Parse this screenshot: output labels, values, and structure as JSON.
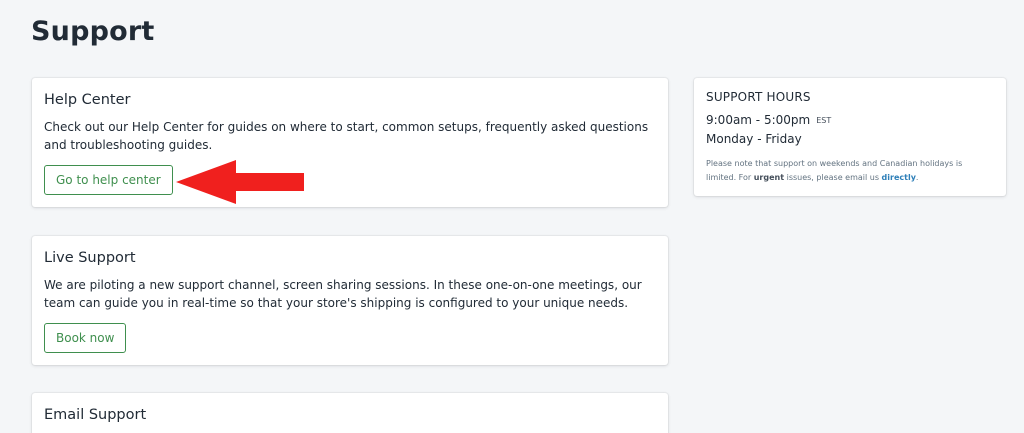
{
  "page": {
    "title": "Support"
  },
  "help_center": {
    "title": "Help Center",
    "text": "Check out our Help Center for guides on where to start, common setups, frequently asked questions and troubleshooting guides.",
    "button_label": "Go to help center"
  },
  "live_support": {
    "title": "Live Support",
    "text": "We are piloting a new support channel, screen sharing sessions. In these one-on-one meetings, our team can guide you in real-time so that your store's shipping is configured to your unique needs.",
    "button_label": "Book now"
  },
  "email_support": {
    "title": "Email Support"
  },
  "support_hours": {
    "title": "SUPPORT HOURS",
    "time": "9:00am - 5:00pm",
    "timezone": "EST",
    "days": "Monday - Friday",
    "note_prefix": "Please note that support on weekends and Canadian holidays is limited. For ",
    "note_bold": "urgent",
    "note_middle": " issues, please email us ",
    "note_link": "directly",
    "note_suffix": "."
  },
  "annotation": {
    "icon": "red-arrow-left-icon",
    "color": "#f0201e"
  },
  "colors": {
    "background": "#f4f6f8",
    "button_green": "#3f8f4e",
    "link_blue": "#2e7fb8",
    "text": "#212b36"
  }
}
